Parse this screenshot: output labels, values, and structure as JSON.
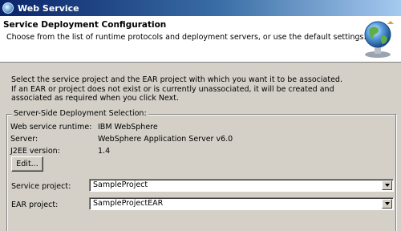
{
  "window": {
    "title": "Web Service"
  },
  "banner": {
    "title": "Service Deployment Configuration",
    "description": "Choose from the list of runtime protocols and deployment servers, or use the default settings.",
    "icon": "globe-icon"
  },
  "instructions": {
    "line1": "Select the service project and the EAR project with which you want it to be associated.",
    "line2": "If an EAR or project does not exist or is currently unassociated, it will be created and",
    "line3": "associated as required when you click Next."
  },
  "deployment": {
    "group_label": "Server-Side Deployment Selection:",
    "runtime_label": "Web service runtime:",
    "runtime_value": "IBM WebSphere",
    "server_label": "Server:",
    "server_value": "WebSphere Application Server v6.0",
    "j2ee_label": "J2EE version:",
    "j2ee_value": "1.4",
    "edit_button": "Edit...",
    "service_project_label": "Service project:",
    "service_project_value": "SampleProject",
    "ear_project_label": "EAR project:",
    "ear_project_value": "SampleProjectEAR"
  }
}
